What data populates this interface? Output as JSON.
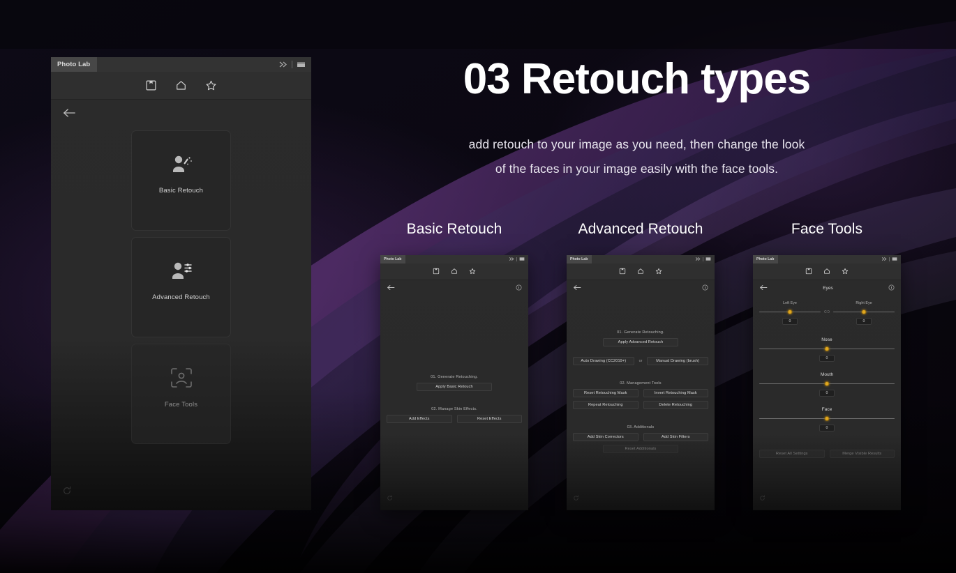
{
  "hero": {
    "title": "03 Retouch types",
    "subtitle_line1": "add retouch to your image as you need, then change the look",
    "subtitle_line2": "of the faces in your image easily with the face tools."
  },
  "colors": {
    "background_dark": "#090611",
    "ribbon_purple": "#4a2a62",
    "panel_bg": "#2b2b2b",
    "titlebar": "#333333",
    "tab_active": "#474747",
    "slider_accent": "#e0a820",
    "text_primary": "#ffffff",
    "text_muted": "#b4b4b4"
  },
  "main_panel": {
    "title": "Photo Lab",
    "titlebar_icons": [
      "chevron-double-right-icon",
      "panel-menu-icon"
    ],
    "toolbar_icons": [
      "save-icon",
      "home-icon",
      "star-icon"
    ],
    "back_icon": "back-arrow-icon",
    "footer_icon": "refresh-icon",
    "cards": [
      {
        "label": "Basic Retouch",
        "icon": "person-wand-icon",
        "dim": false
      },
      {
        "label": "Advanced Retouch",
        "icon": "person-sliders-icon",
        "dim": false
      },
      {
        "label": "Face Tools",
        "icon": "face-scan-icon",
        "dim": true
      }
    ]
  },
  "columns": [
    {
      "heading": "Basic Retouch"
    },
    {
      "heading": "Advanced Retouch"
    },
    {
      "heading": "Face Tools"
    }
  ],
  "panel_basic": {
    "title": "Photo Lab",
    "titlebar_icons": [
      "chevron-double-right-icon",
      "panel-menu-icon"
    ],
    "toolbar_icons": [
      "save-icon",
      "home-icon",
      "star-icon"
    ],
    "back_icon": "back-arrow-icon",
    "info_icon": "info-icon",
    "footer_icon": "refresh-icon",
    "section1_label": "01. Generate Retouching.",
    "apply_button": "Apply Basic Retouch",
    "section2_label": "02. Manage Skin Effects.",
    "add_effects_button": "Add Effects",
    "reset_effects_button": "Reset Effects"
  },
  "panel_advanced": {
    "title": "Photo Lab",
    "titlebar_icons": [
      "chevron-double-right-icon",
      "panel-menu-icon"
    ],
    "toolbar_icons": [
      "save-icon",
      "home-icon",
      "star-icon"
    ],
    "back_icon": "back-arrow-icon",
    "info_icon": "info-icon",
    "footer_icon": "refresh-icon",
    "section1_label": "01. Generate Retouching.",
    "apply_button": "Apply Advanced Retouch",
    "auto_drawing_button": "Auto Drawing (CC2019+)",
    "or_text": "or",
    "manual_drawing_button": "Manual Drawing (brush)",
    "section2_label": "02. Management Tools",
    "reset_mask_button": "Reset Retouching Mask",
    "invert_mask_button": "Invert Retouching Mask",
    "repeat_button": "Repeat Retouching",
    "delete_button": "Delete Retouching",
    "section3_label": "03. Additionals",
    "add_correctors_button": "Add Skin Correctors",
    "add_filters_button": "Add Skin Filters",
    "reset_additionals_button": "Reset Additionals"
  },
  "panel_face": {
    "title": "Photo Lab",
    "titlebar_icons": [
      "chevron-double-right-icon",
      "panel-menu-icon"
    ],
    "toolbar_icons": [
      "save-icon",
      "home-icon",
      "star-icon"
    ],
    "back_icon": "back-arrow-icon",
    "info_icon": "info-icon",
    "footer_icon": "refresh-icon",
    "eyes_heading": "Eyes",
    "left_eye_label": "Left Eye",
    "right_eye_label": "Right Eye",
    "left_eye_value": "0",
    "right_eye_value": "0",
    "link_icon": "link-icon",
    "nose_label": "Nose",
    "nose_value": "0",
    "mouth_label": "Mouth",
    "mouth_value": "0",
    "face_label": "Face",
    "face_value": "0",
    "reset_all_button": "Reset All Settings",
    "merge_button": "Merge Visible Results"
  }
}
